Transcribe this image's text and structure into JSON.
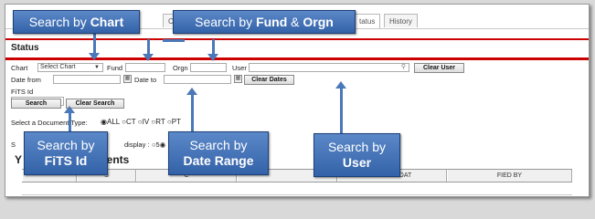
{
  "tabs": [
    "der",
    "C",
    "tatus",
    "History"
  ],
  "status_title": "Status",
  "form": {
    "chart_label": "Chart",
    "chart_value": "Select Chart",
    "fund_label": "Fund",
    "orgn_label": "Orgn",
    "user_label": "User",
    "clear_user": "Clear User",
    "date_from_label": "Date from",
    "date_to_label": "Date to",
    "clear_dates": "Clear Dates",
    "fits_label": "FiTS Id",
    "search_btn": "Search",
    "clear_search_btn": "Clear Search",
    "doc_type_label": "Select a Document Type:",
    "doc_types": [
      "ALL",
      "CT",
      "IV",
      "RT",
      "PT"
    ],
    "display_label": "display :",
    "display_value": "5"
  },
  "results_heading": "Y...ments",
  "table_headers": [
    "S",
    "C",
    "ST MOD DAT",
    "FIED BY"
  ],
  "callouts": {
    "chart": {
      "pre": "Search by ",
      "bold": "Chart"
    },
    "fund": {
      "pre": "Search by ",
      "bold": "Fund",
      "mid": " & ",
      "bold2": "Orgn"
    },
    "fits": {
      "line1": "Search by",
      "bold": "FiTS Id"
    },
    "date": {
      "line1": "Search by",
      "bold": "Date Range"
    },
    "user": {
      "line1": "Search by",
      "bold": "User"
    }
  }
}
